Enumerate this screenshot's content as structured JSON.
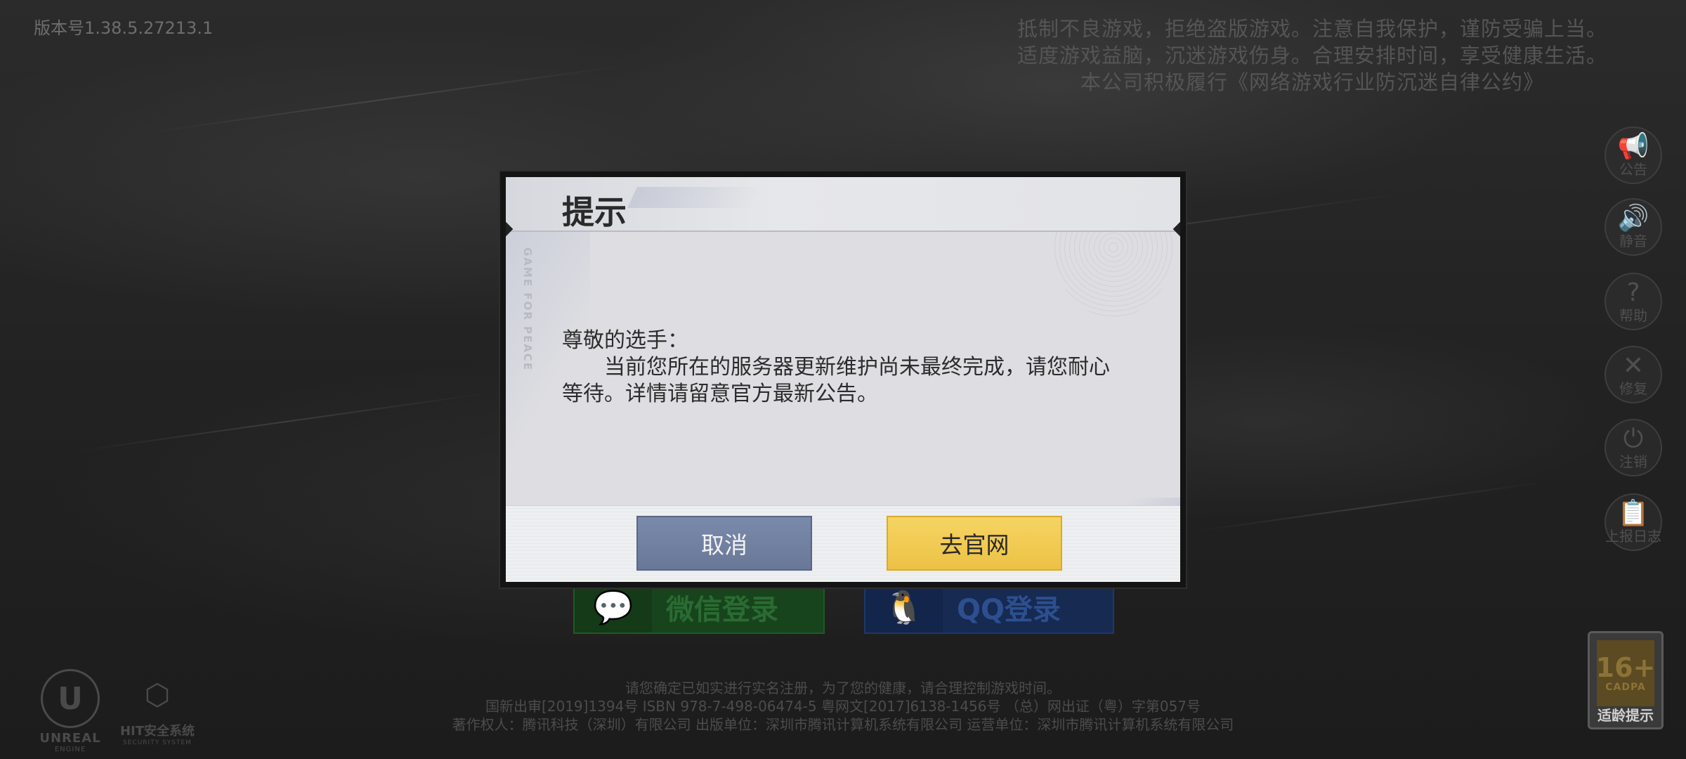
{
  "version": "版本号1.38.5.27213.1",
  "warning": {
    "lines": [
      "抵制不良游戏，拒绝盗版游戏。注意自我保护，谨防受骗上当。",
      "适度游戏益脑，沉迷游戏伤身。合理安排时间，享受健康生活。",
      "本公司积极履行《网络游戏行业防沉迷自律公约》"
    ]
  },
  "side_menu": [
    {
      "label": "公告",
      "icon": "megaphone-icon"
    },
    {
      "label": "静音",
      "icon": "speaker-icon"
    },
    {
      "label": "帮助",
      "icon": "question-icon"
    },
    {
      "label": "修复",
      "icon": "wrench-icon"
    },
    {
      "label": "注销",
      "icon": "power-icon"
    },
    {
      "label": "上报日志",
      "icon": "clipboard-upload-icon"
    }
  ],
  "login": {
    "wechat_label": "微信登录",
    "qq_label": "QQ登录"
  },
  "legal": {
    "lines": [
      "请您确定已如实进行实名注册，为了您的健康，请合理控制游戏时间。",
      "国新出审[2019]1394号  ISBN 978-7-498-06474-5  粤网文[2017]6138-1456号  （总）网出证（粤）字第057号",
      "著作权人：腾讯科技（深圳）有限公司   出版单位：深圳市腾讯计算机系统有限公司   运营单位：深圳市腾讯计算机系统有限公司"
    ]
  },
  "logos": {
    "unreal_line1": "UNREAL",
    "unreal_line2": "ENGINE",
    "hit_line1": "HIT安全系统",
    "hit_line2": "SECURITY SYSTEM"
  },
  "age_rating": {
    "number": "16+",
    "org": "CADPA",
    "label": "适龄提示"
  },
  "dialog": {
    "title": "提示",
    "side_text": "GAME FOR PEACE",
    "greeting": "尊敬的选手：",
    "message": "当前您所在的服务器更新维护尚未最终完成，请您耐心等待。详情请留意官方最新公告。",
    "cancel_label": "取消",
    "website_label": "去官网"
  },
  "colors": {
    "cancel_button": "#7080a0",
    "website_button": "#f2cc55",
    "wechat_green": "#17441c",
    "qq_blue": "#162a52"
  }
}
